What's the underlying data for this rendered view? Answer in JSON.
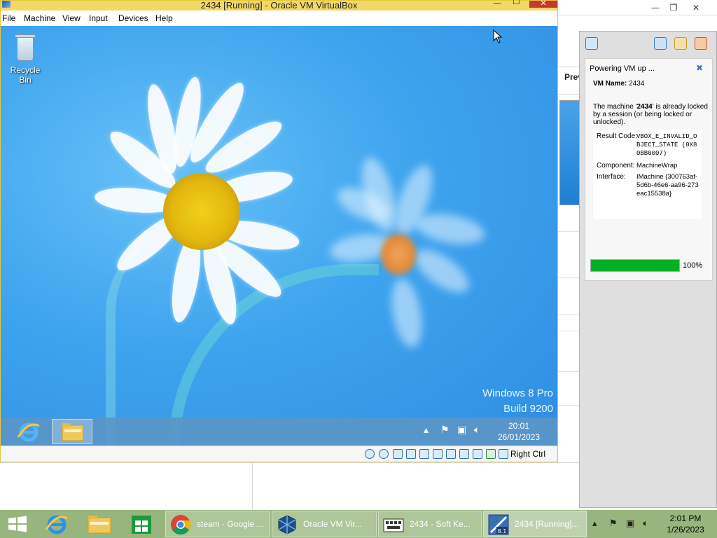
{
  "host_window_controls": {
    "minimize": "—",
    "restore": "❐",
    "close": "✕"
  },
  "manager_preview": {
    "label": "Prev"
  },
  "vm_window": {
    "title": "2434 [Running] - Oracle VM VirtualBox",
    "controls": {
      "minimize": "—",
      "maximize": "☐",
      "close": "✕"
    },
    "menu": [
      "File",
      "Machine",
      "View",
      "Input",
      "Devices",
      "Help"
    ],
    "status_host_key": "Right Ctrl"
  },
  "guest_desktop": {
    "recycle_bin_label": "Recycle Bin",
    "watermark_line1": "Windows 8 Pro",
    "watermark_line2": "Build 9200",
    "clock_time": "20:01",
    "clock_date": "26/01/2023"
  },
  "notification": {
    "title": "Powering VM up ...",
    "vm_name_label": "VM Name:",
    "vm_name": "2434",
    "message_prefix": "The machine '",
    "message_name": "2434",
    "message_suffix": "' is already locked by a session (or being locked or unlocked).",
    "result_code_label": "Result Code:",
    "result_code": "VBOX_E_INVALID_OBJECT_STATE (0X80BB0007)",
    "component_label": "Component:",
    "component": "MachineWrap",
    "interface_label": "Interface:",
    "interface": "IMachine {300763af-5d6b-46e6-aa96-273eac15538a}",
    "progress_percent": 100,
    "progress_label": "100%"
  },
  "host_taskbar": {
    "buttons": [
      {
        "label": "steam - Google ..."
      },
      {
        "label": "Oracle VM Vir..."
      },
      {
        "label": "2434 - Soft Ke..."
      },
      {
        "label": "2434 [Running]..."
      }
    ],
    "clock_time": "2:01 PM",
    "clock_date": "1/26/2023"
  },
  "colors": {
    "vm_frame": "#f2d866",
    "guest_sky": "#3ea4ee",
    "progress": "#06b025",
    "host_taskbar": "#97b67e",
    "close_red": "#c7372f"
  }
}
